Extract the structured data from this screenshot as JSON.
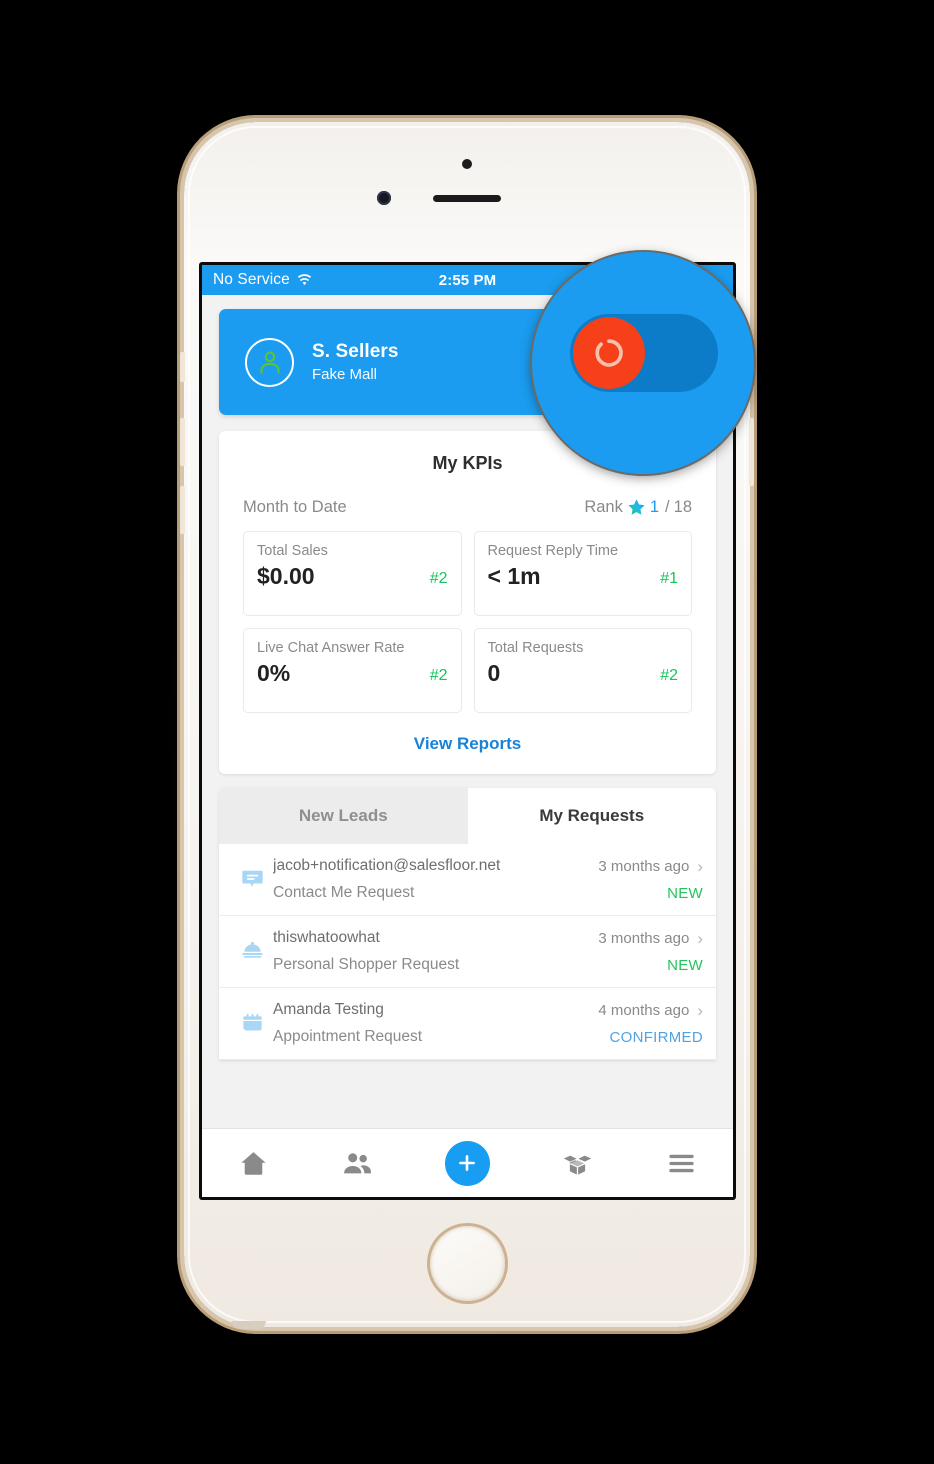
{
  "status_bar": {
    "carrier": "No Service",
    "wifi_icon": "wifi-icon",
    "time": "2:55 PM"
  },
  "profile": {
    "avatar_icon": "person-avatar-icon",
    "name": "S. Sellers",
    "store": "Fake Mall",
    "toggle_state": "on"
  },
  "kpi": {
    "title": "My KPIs",
    "period_label": "Month to Date",
    "rank_label": "Rank",
    "rank_star_icon": "star-icon",
    "rank_value": "1",
    "rank_separator": "/",
    "rank_total": "18",
    "boxes": [
      {
        "label": "Total Sales",
        "value": "$0.00",
        "rank": "#2"
      },
      {
        "label": "Request Reply Time",
        "value": "< 1m",
        "rank": "#1"
      },
      {
        "label": "Live Chat Answer Rate",
        "value": "0%",
        "rank": "#2"
      },
      {
        "label": "Total Requests",
        "value": "0",
        "rank": "#2"
      }
    ],
    "view_reports": "View Reports"
  },
  "tabs": {
    "new_leads": "New Leads",
    "my_requests": "My Requests",
    "active": "my_requests"
  },
  "requests": [
    {
      "icon": "chat-bubble-icon",
      "name": "jacob+notification@salesfloor.net",
      "type": "Contact Me Request",
      "time": "3 months ago",
      "chevron": "chevron-right-icon",
      "status": "NEW",
      "status_kind": "new"
    },
    {
      "icon": "cloche-icon",
      "name": "thiswhatoowhat",
      "type": "Personal Shopper Request",
      "time": "3 months ago",
      "chevron": "chevron-right-icon",
      "status": "NEW",
      "status_kind": "new"
    },
    {
      "icon": "calendar-icon",
      "name": "Amanda Testing",
      "type": "Appointment Request",
      "time": "4 months ago",
      "chevron": "chevron-right-icon",
      "status": "CONFIRMED",
      "status_kind": "confirmed"
    }
  ],
  "tabbar": [
    {
      "icon": "home-icon",
      "name": "home"
    },
    {
      "icon": "people-icon",
      "name": "customers"
    },
    {
      "icon": "plus-icon",
      "name": "add"
    },
    {
      "icon": "open-box-icon",
      "name": "products"
    },
    {
      "icon": "hamburger-menu-icon",
      "name": "menu"
    }
  ],
  "magnifier": {
    "highlight_target": "profile-toggle",
    "knob_icon": "loading-ring-icon"
  },
  "colors": {
    "brand_blue": "#1b9cf0",
    "link_blue": "#1b81d6",
    "success_green": "#23c45e",
    "confirmed_blue": "#4fa3e3",
    "toggle_knob_orange": "#f5401a",
    "toggle_track_blue": "#0c7cc9",
    "avatar_green": "#5bc236"
  }
}
